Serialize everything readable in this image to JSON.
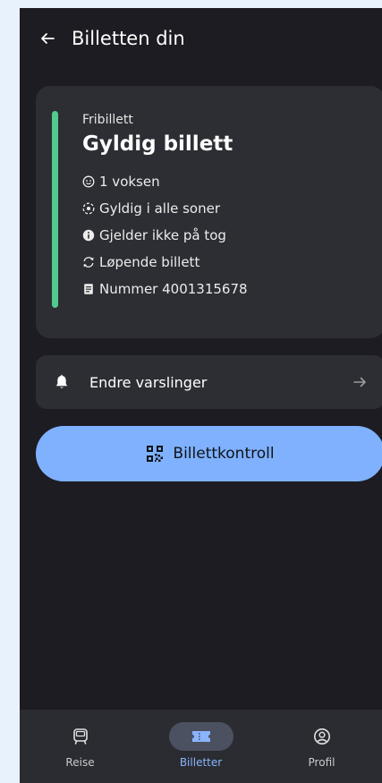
{
  "header": {
    "title": "Billetten din",
    "back_icon": "arrow-left-icon"
  },
  "ticket": {
    "type": "Fribillett",
    "status": "Gyldig billett",
    "status_color": "#52c98e",
    "details": [
      {
        "icon": "person-icon",
        "text": "1 voksen"
      },
      {
        "icon": "zone-icon",
        "text": "Gyldig i alle soner"
      },
      {
        "icon": "info-icon",
        "text": "Gjelder ikke på tog"
      },
      {
        "icon": "refresh-icon",
        "text": "Løpende billett"
      },
      {
        "icon": "receipt-icon",
        "text": "Nummer 4001315678"
      }
    ]
  },
  "notifications": {
    "label": "Endre varslinger",
    "icon": "bell-icon",
    "arrow_icon": "arrow-right-icon"
  },
  "control": {
    "label": "Billettkontroll",
    "icon": "qr-code-icon",
    "color": "#7fb1ff"
  },
  "nav": {
    "items": [
      {
        "label": "Reise",
        "icon": "bus-icon",
        "active": false
      },
      {
        "label": "Billetter",
        "icon": "ticket-icon",
        "active": true
      },
      {
        "label": "Profil",
        "icon": "profile-icon",
        "active": false
      }
    ],
    "active_color": "#8ab4ff"
  }
}
